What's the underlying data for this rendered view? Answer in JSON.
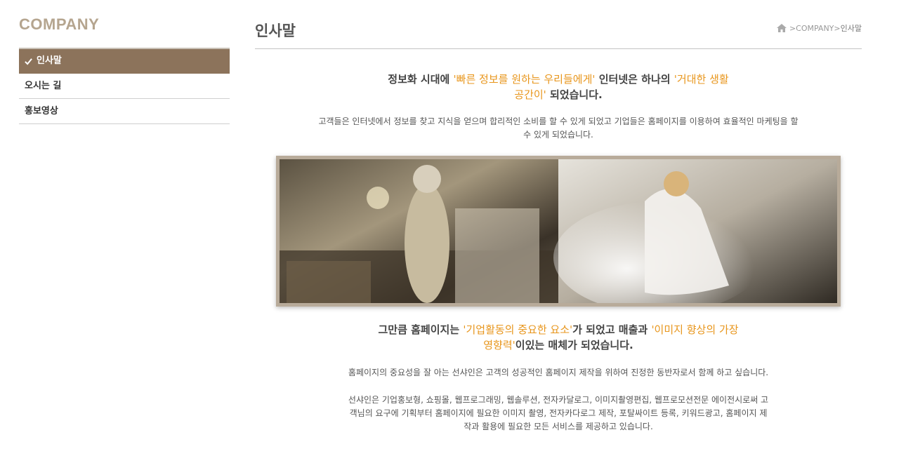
{
  "sidebar": {
    "title": "COMPANY",
    "items": [
      {
        "label": "인사말",
        "active": true
      },
      {
        "label": "오시는 길",
        "active": false
      },
      {
        "label": "홍보영상",
        "active": false
      }
    ]
  },
  "header": {
    "page_title": "인사말",
    "breadcrumb": {
      "sep1": " > ",
      "level1": "COMPANY",
      "sep2": " > ",
      "current": "인사말"
    }
  },
  "content": {
    "headline1": {
      "t1": "정보화 시대에 ",
      "h1": "'빠른 정보를 원하는 우리들에게'",
      "t2": " 인터넷은 하나의 ",
      "h2": "'거대한 생활공간이'",
      "t3": " 되었습니다."
    },
    "paragraph1": "고객들은 인터넷에서 정보를 찾고 지식을 얻으며 합리적인 소비를 할 수 있게 되었고 기업들은 홈페이지를 이용하여 효율적인 마케팅을 할 수 있게 되었습니다.",
    "headline2": {
      "t1": "그만큼 홈페이지는 ",
      "h1": "'기업활동의 중요한 요소'",
      "t2": "가 되었고 매출과 ",
      "h2": "'이미지 향상의 가장 영향력'",
      "t3": "이있는 매체가 되었습니다."
    },
    "paragraph2": "홈페이지의 중요성을 잘 아는 선샤인은 고객의 성공적인 홈페이지 제작을 위하여 진정한 동반자로서 함께 하고 싶습니다.",
    "paragraph3": "선샤인은 기업홍보형, 쇼핑몰, 웹프로그래밍, 웹솔루션, 전자카달로그, 이미지촬영편집, 웹프로모션전문 에이전시로써 고객님의 요구에 기획부터 홈페이지에 필요한 이미지 촬영, 전자카다로그 제작, 포탈싸이트 등록, 키워드광고, 홈페이지 제작과 활용에 필요한 모든 서비스를 제공하고 있습니다."
  },
  "colors": {
    "accent_brown": "#8c735b",
    "title_beige": "#b5a58f",
    "highlight_orange": "#e8961c"
  },
  "icons": [
    "check-icon",
    "home-icon"
  ]
}
